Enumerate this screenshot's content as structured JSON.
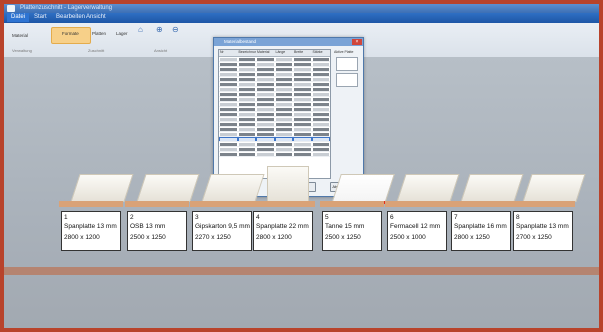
{
  "window": {
    "title": "Plattenzuschnitt - Lagerverwaltung"
  },
  "menu": {
    "tabs": [
      "Datei",
      "Start",
      "Bearbeiten",
      "Ansicht"
    ]
  },
  "ribbon": {
    "buttons": [
      "Material",
      "Formate",
      "Platten",
      "Lager"
    ],
    "groups": [
      "Verwaltung",
      "Zuschnitt",
      "Ansicht"
    ],
    "icons": [
      "home-icon",
      "zoom-in-icon",
      "zoom-out-icon"
    ]
  },
  "dialog": {
    "title": "Materialbestand",
    "columns": [
      "Nr",
      "Bezeichnung",
      "Material",
      "Länge",
      "Breite",
      "Stärke"
    ],
    "side_label": "Aktive Platte",
    "ok_label": "OK",
    "cancel_label": "Abbrechen"
  },
  "panels": [
    {
      "num": "1",
      "name": "Spanplatte  13 mm",
      "dims": "2800 x 1200"
    },
    {
      "num": "2",
      "name": "OSB  13 mm",
      "dims": "2500 x 1250"
    },
    {
      "num": "3",
      "name": "Gipskarton  9,5 mm",
      "dims": "2270 x 1250"
    },
    {
      "num": "4",
      "name": "Spanplatte  22 mm",
      "dims": "2800 x 1200"
    },
    {
      "num": "5",
      "name": "Tanne  15 mm",
      "dims": "2500 x 1250"
    },
    {
      "num": "6",
      "name": "Fermacell  12 mm",
      "dims": "2500 x 1000"
    },
    {
      "num": "7",
      "name": "Spanplatte  16 mm",
      "dims": "2800 x 1250"
    },
    {
      "num": "8",
      "name": "Spanplatte  13 mm",
      "dims": "2700 x 1250"
    }
  ]
}
